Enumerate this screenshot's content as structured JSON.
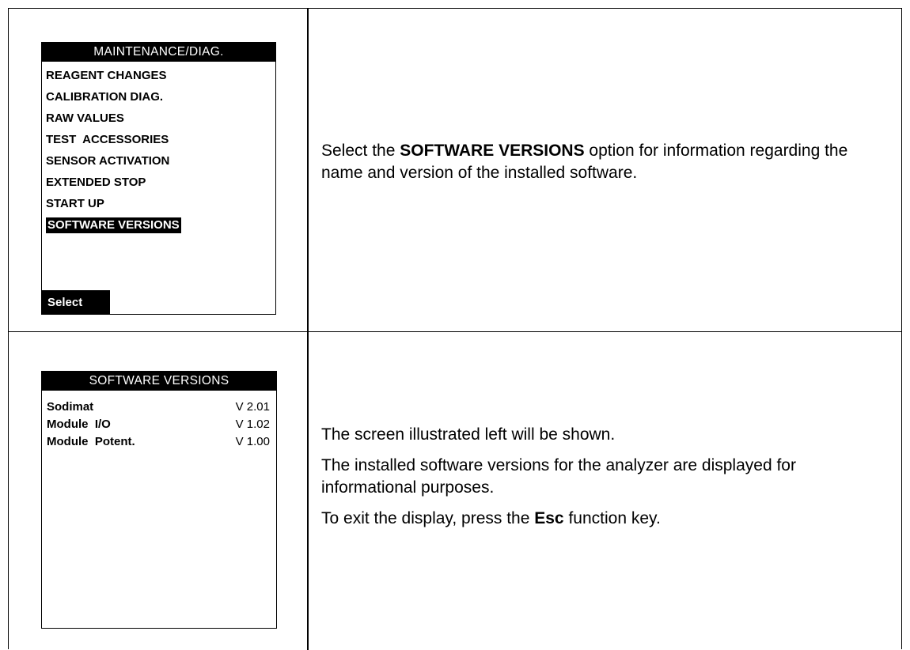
{
  "screen1": {
    "title": "MAINTENANCE/DIAG.",
    "menu_items": [
      "REAGENT CHANGES",
      "CALIBRATION DIAG.",
      "RAW VALUES",
      "TEST  ACCESSORIES",
      "SENSOR ACTIVATION",
      "EXTENDED STOP",
      "START UP",
      "SOFTWARE VERSIONS"
    ],
    "selected_item": "SOFTWARE VERSIONS",
    "softkey": "Select"
  },
  "text1": {
    "before": "Select the ",
    "bold": "SOFTWARE VERSIONS",
    "after": " option for information regarding the name and version of the installed software."
  },
  "screen2": {
    "title": "SOFTWARE VERSIONS",
    "rows": [
      {
        "name": "Sodimat",
        "version": "V 2.01"
      },
      {
        "name": "Module  I/O",
        "version": "V 1.02"
      },
      {
        "name": "Module  Potent.",
        "version": "V 1.00"
      }
    ]
  },
  "text2": {
    "p1": "The screen illustrated left will be shown.",
    "p2": "The installed software versions for the analyzer are displayed for informational purposes.",
    "p3_before": "To exit the display, press the ",
    "p3_bold": "Esc",
    "p3_after": " function key."
  }
}
